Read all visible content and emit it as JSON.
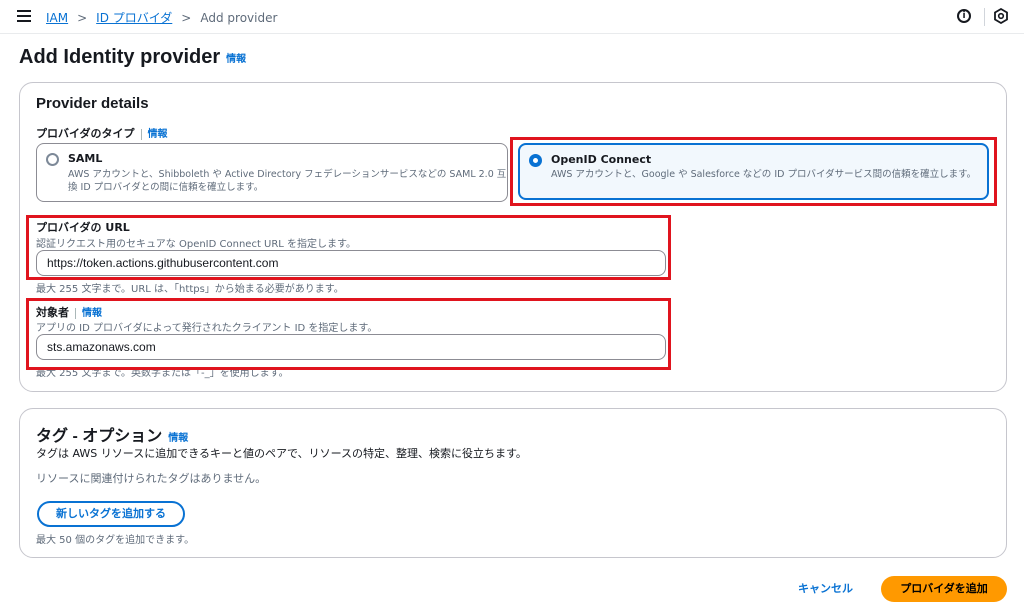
{
  "breadcrumb": {
    "item1": "IAM",
    "item2": "ID プロバイダ",
    "current": "Add provider",
    "sep": ">"
  },
  "header": {
    "info_icon": "i"
  },
  "page": {
    "title": "Add Identity provider",
    "info": "情報"
  },
  "provider_details": {
    "title": "Provider details",
    "type_label": "プロバイダのタイプ",
    "type_info": "情報",
    "options": [
      {
        "title": "SAML",
        "desc_line1": "AWS アカウントと、Shibboleth や Active Directory フェデレーションサービスなどの SAML 2.0 互",
        "desc_line2": "換 ID プロバイダとの間に信頼を確立します。",
        "selected": false
      },
      {
        "title": "OpenID Connect",
        "desc_line1": "AWS アカウントと、Google や Salesforce などの ID プロバイダサービス間の信頼を確立します。",
        "selected": true
      }
    ],
    "url_label": "プロバイダの URL",
    "url_desc": "認証リクエスト用のセキュアな OpenID Connect URL を指定します。",
    "url_value": "https://token.actions.githubusercontent.com",
    "url_hint": "最大 255 文字まで。URL は、「https」から始まる必要があります。",
    "aud_label": "対象者",
    "aud_info": "情報",
    "aud_desc": "アプリの ID プロバイダによって発行されたクライアント ID を指定します。",
    "aud_value": "sts.amazonaws.com",
    "aud_hint": "最大 255 文字まで。英数字または「-_」を使用します。"
  },
  "tags": {
    "title": "タグ - オプション",
    "info": "情報",
    "desc": "タグは AWS リソースに追加できるキーと値のペアで、リソースの特定、整理、検索に役立ちます。",
    "empty": "リソースに関連付けられたタグはありません。",
    "add_button": "新しいタグを追加する",
    "hint": "最大 50 個のタグを追加できます。"
  },
  "footer": {
    "cancel": "キャンセル",
    "submit": "プロバイダを追加"
  },
  "colors": {
    "accent": "#0972d3",
    "primary": "#ff9900",
    "highlight": "#e0141e"
  },
  "icons": {
    "menu": "menu-icon",
    "info": "info-icon",
    "settings": "settings-icon"
  }
}
